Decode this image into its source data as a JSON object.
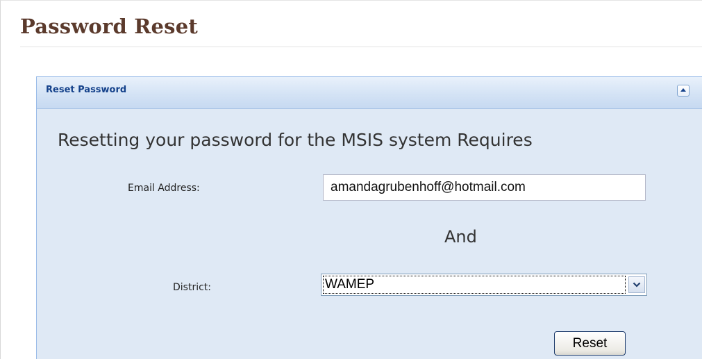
{
  "page": {
    "title": "Password Reset"
  },
  "panel": {
    "title": "Reset Password",
    "collapse_icon": "collapse-up-icon",
    "heading": "Resetting your password for the MSIS system Requires",
    "email": {
      "label": "Email Address:",
      "value": "amandagrubenhoff@hotmail.com"
    },
    "and_text": "And",
    "district": {
      "label": "District:",
      "selected": "WAMEP",
      "dropdown_icon": "chevron-down-icon"
    },
    "reset_label": "Reset"
  },
  "colors": {
    "title": "#5b3a2c",
    "panel_title": "#15428b",
    "panel_bg": "#dfe9f5",
    "panel_border": "#99bbe8"
  }
}
